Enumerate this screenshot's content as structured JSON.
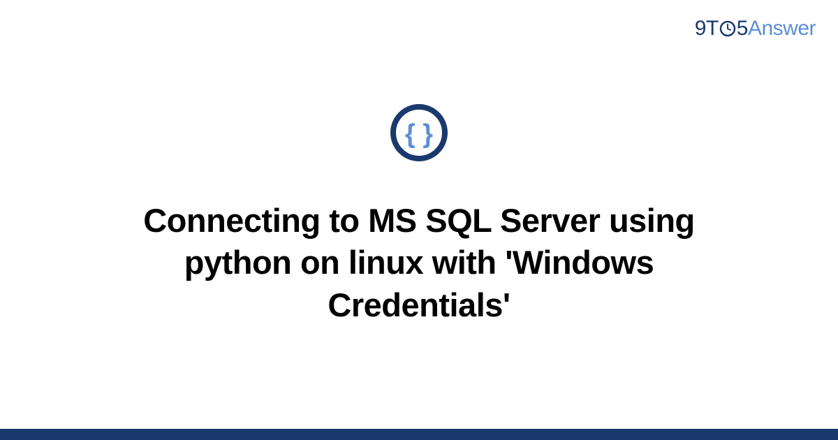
{
  "logo": {
    "part1": "9",
    "part2": "T",
    "part3": "5",
    "part4": "Answer"
  },
  "icon": {
    "name": "curly-braces-icon",
    "ring_color": "#1a3a6e",
    "brace_color": "#5b8fd6"
  },
  "title": "Connecting to MS SQL Server using python on linux with 'Windows Credentials'",
  "colors": {
    "bottom_bar": "#1a3a6e"
  }
}
